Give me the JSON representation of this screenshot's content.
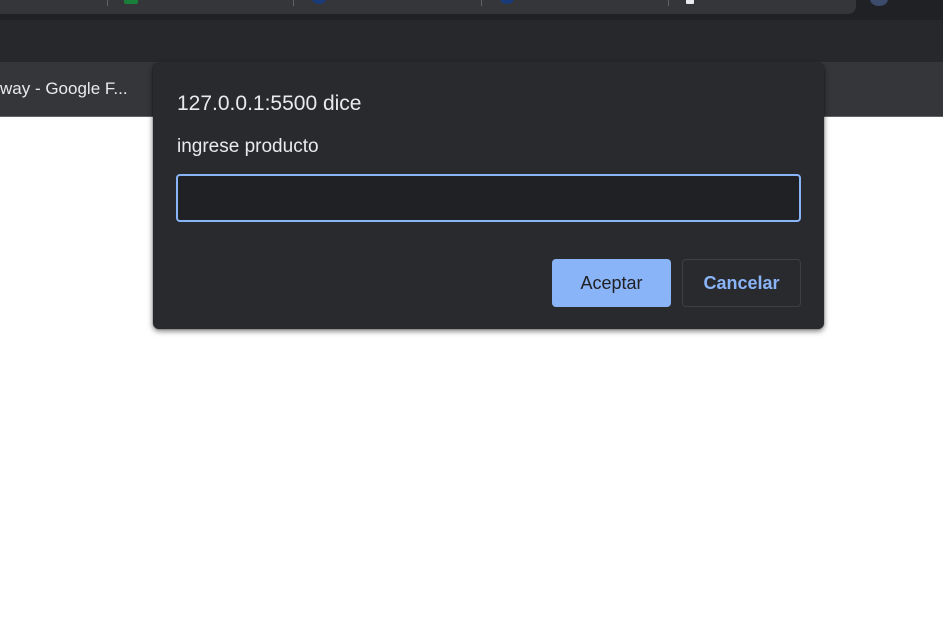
{
  "browser": {
    "bookmark_label": "way - Google F...",
    "tab_icons": [
      "sheets-icon",
      "globe-icon",
      "globe-icon",
      "page-icon"
    ]
  },
  "dialog": {
    "title": "127.0.0.1:5500 dice",
    "message": "ingrese producto",
    "input_value": "",
    "input_placeholder": "",
    "ok_label": "Aceptar",
    "cancel_label": "Cancelar"
  },
  "colors": {
    "accent": "#8ab4f8",
    "dialog_bg": "#292a2d",
    "chrome_bg": "#202124"
  }
}
